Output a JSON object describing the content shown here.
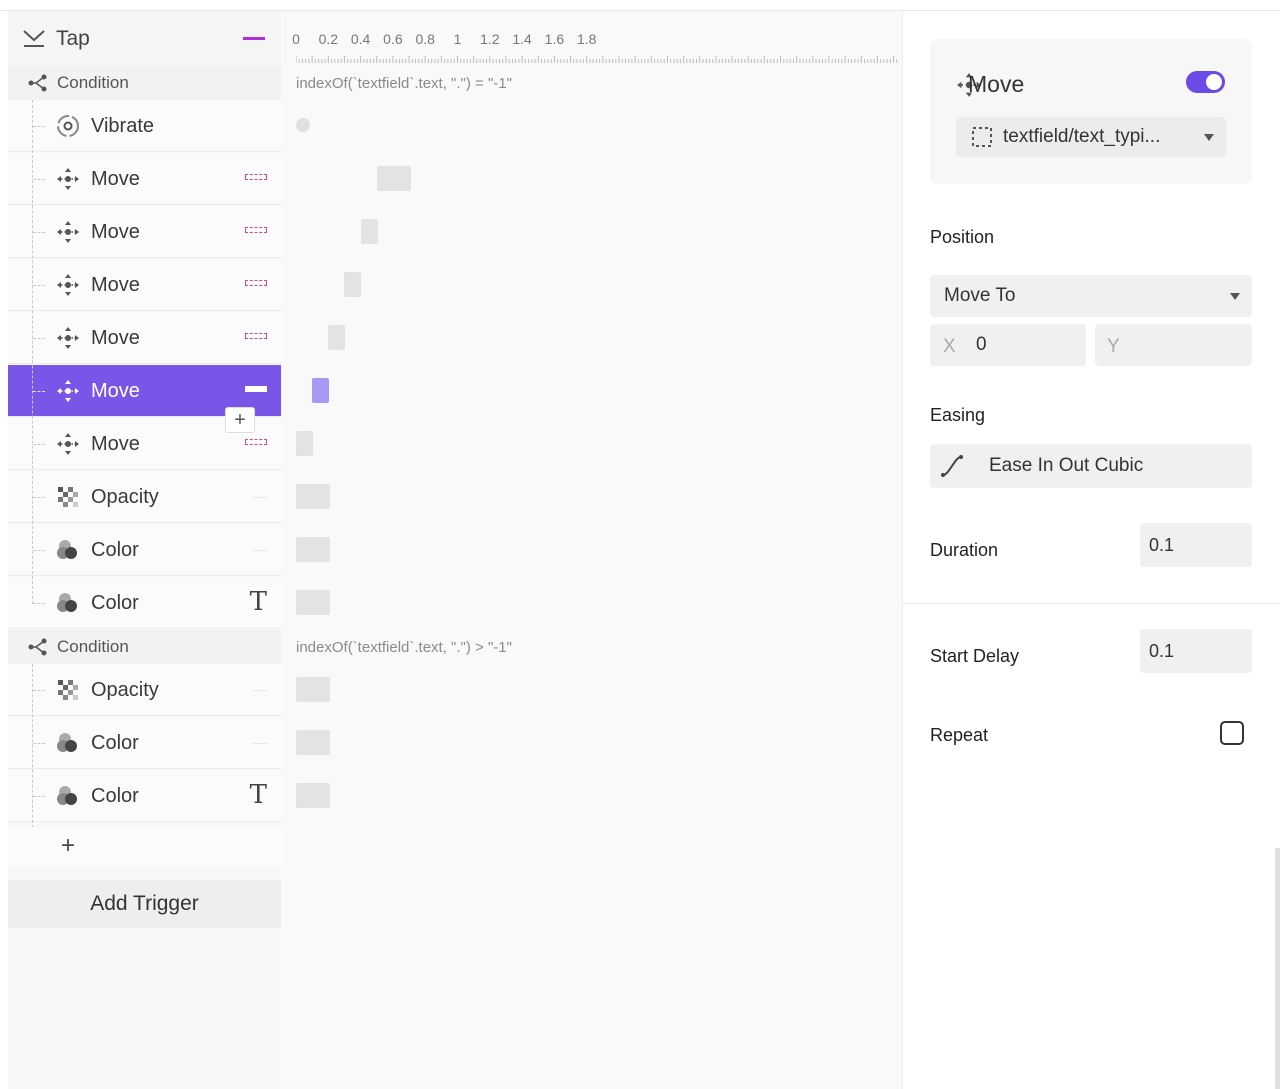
{
  "tree": {
    "trigger": {
      "label": "Tap"
    },
    "groups": [
      {
        "condition": {
          "label": "Condition",
          "expression": "indexOf(`textfield`.text, \".\") = \"-1\""
        },
        "items": [
          {
            "label": "Vibrate",
            "icon": "vibrate-icon",
            "action": "none"
          },
          {
            "label": "Move",
            "icon": "move-icon",
            "action": "delete-marker"
          },
          {
            "label": "Move",
            "icon": "move-icon",
            "action": "delete-marker"
          },
          {
            "label": "Move",
            "icon": "move-icon",
            "action": "delete-marker"
          },
          {
            "label": "Move",
            "icon": "move-icon",
            "action": "delete-marker"
          },
          {
            "label": "Move",
            "icon": "move-icon",
            "action": "delete-marker",
            "selected": true
          },
          {
            "label": "Move",
            "icon": "move-icon",
            "action": "delete-marker"
          },
          {
            "label": "Opacity",
            "icon": "opacity-icon",
            "action": "dash"
          },
          {
            "label": "Color",
            "icon": "color-icon",
            "action": "dash"
          },
          {
            "label": "Color",
            "icon": "color-icon",
            "action": "text-T"
          }
        ]
      },
      {
        "condition": {
          "label": "Condition",
          "expression": "indexOf(`textfield`.text, \".\") > \"-1\""
        },
        "items": [
          {
            "label": "Opacity",
            "icon": "opacity-icon",
            "action": "dash"
          },
          {
            "label": "Color",
            "icon": "color-icon",
            "action": "dash"
          },
          {
            "label": "Color",
            "icon": "color-icon",
            "action": "text-T"
          }
        ]
      }
    ],
    "add_item": "+",
    "insert_button": "+",
    "add_trigger_label": "Add Trigger",
    "text_action_glyph": "T"
  },
  "timeline": {
    "ruler_labels": [
      "0",
      "0.2",
      "0.4",
      "0.6",
      "0.8",
      "1",
      "1.2",
      "1.4",
      "1.6",
      "1.8"
    ],
    "ruler_values": [
      0,
      0.2,
      0.4,
      0.6,
      0.8,
      1,
      1.2,
      1.4,
      1.6,
      1.8
    ],
    "bars": [
      {
        "start": 0,
        "duration": 0
      },
      {
        "start": 0.5,
        "duration": 0.2
      },
      {
        "start": 0.4,
        "duration": 0.1
      },
      {
        "start": 0.3,
        "duration": 0.1
      },
      {
        "start": 0.2,
        "duration": 0.1
      },
      {
        "start": 0.1,
        "duration": 0.1
      },
      {
        "start": 0,
        "duration": 0.1
      },
      {
        "start": 0,
        "duration": 0.2
      },
      {
        "start": 0,
        "duration": 0.2
      },
      {
        "start": 0,
        "duration": 0.2
      },
      {
        "start": 0,
        "duration": 0.2
      },
      {
        "start": 0,
        "duration": 0.2
      },
      {
        "start": 0,
        "duration": 0.2
      }
    ]
  },
  "panel": {
    "title": "Move",
    "enabled": true,
    "target": "textfield/text_typi...",
    "position_label": "Position",
    "position_mode": "Move To",
    "x_label": "X",
    "x_value": "0",
    "y_label": "Y",
    "y_value": "",
    "easing_label": "Easing",
    "easing_value": "Ease In Out Cubic",
    "duration_label": "Duration",
    "duration_value": "0.1",
    "start_delay_label": "Start Delay",
    "start_delay_value": "0.1",
    "repeat_label": "Repeat",
    "repeat": false
  },
  "colors": {
    "accent": "#7a55e8",
    "toggle": "#6b4ae6",
    "selected_bar": "#aa98f4",
    "delete_marker": "#e0457b",
    "trigger_marker": "#b02fd8"
  }
}
